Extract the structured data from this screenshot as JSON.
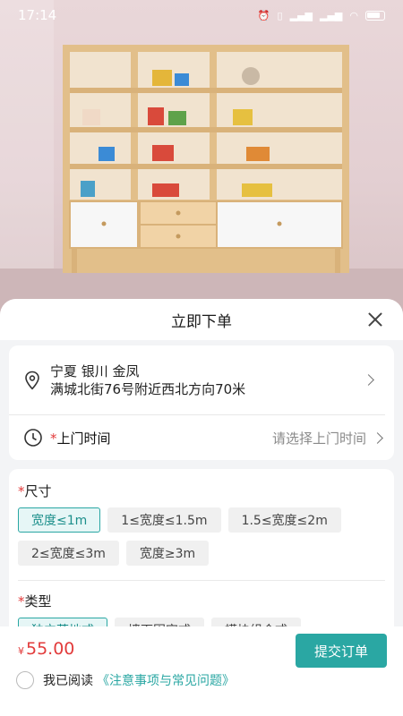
{
  "status_bar": {
    "time": "17:14",
    "icons": [
      "alarm-icon",
      "vibrate-icon",
      "signal-icon",
      "signal-icon",
      "wifi-icon",
      "battery-icon"
    ]
  },
  "product_image": {
    "subject": "wooden toy shelf with white drawers"
  },
  "sheet": {
    "title": "立即下单",
    "address": {
      "line1": "宁夏 银川 金凤",
      "line2": "满城北街76号附近西北方向70米"
    },
    "visit_time": {
      "required_mark": "*",
      "label": "上门时间",
      "placeholder": "请选择上门时间"
    },
    "size_group": {
      "required_mark": "*",
      "title": "尺寸",
      "options": [
        "宽度≤1m",
        "1≤宽度≤1.5m",
        "1.5≤宽度≤2m",
        "2≤宽度≤3m",
        "宽度≥3m"
      ],
      "selected_index": 0
    },
    "type_group": {
      "required_mark": "*",
      "title": "类型",
      "options": [
        "独立落地式",
        "墙面固定式",
        "模块组合式"
      ],
      "selected_index": 0
    }
  },
  "bottom_bar": {
    "currency": "¥",
    "price": "55.00",
    "submit_label": "提交订单",
    "agree_prefix": "我已阅读",
    "agree_link": "《注意事项与常见问题》"
  },
  "colors": {
    "accent": "#2aa7a3",
    "price": "#e23b3b",
    "required": "#e23b3b"
  }
}
